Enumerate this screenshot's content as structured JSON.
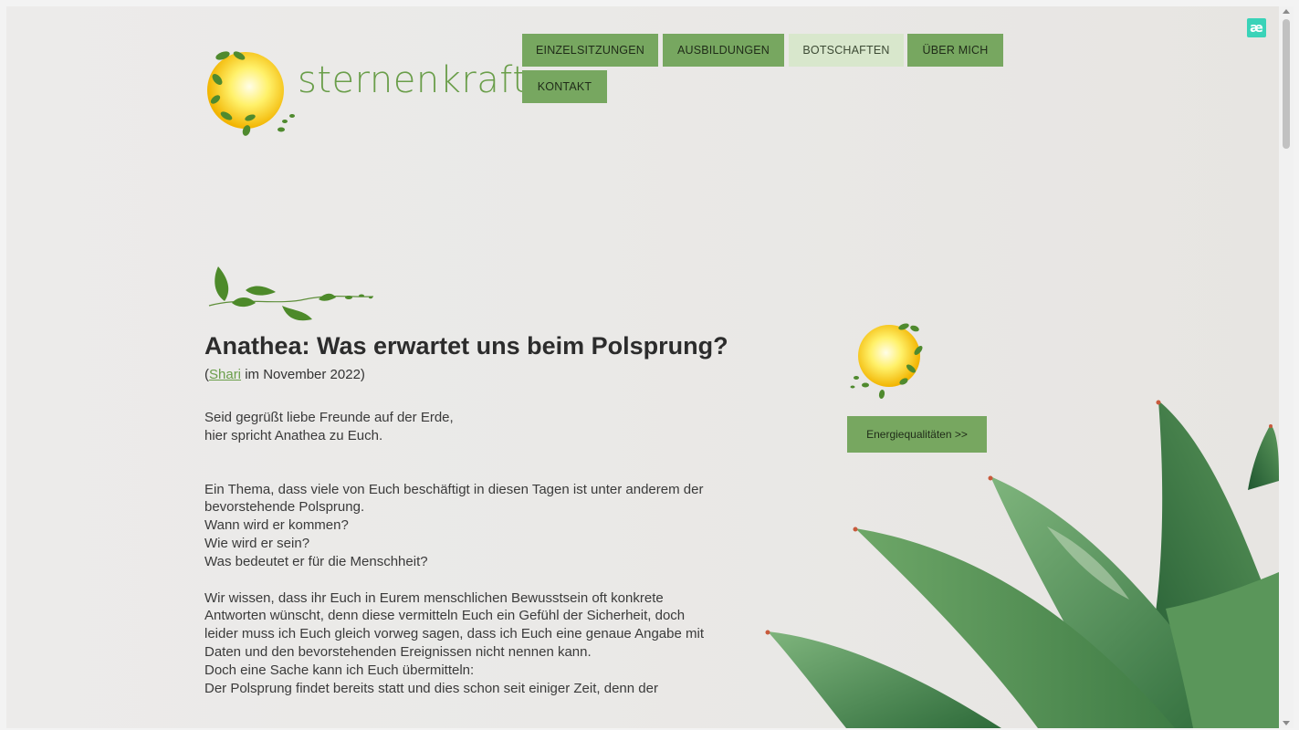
{
  "brand": {
    "name": "sternenkraft",
    "logo_icon": "sun-with-leaves-icon"
  },
  "extension": {
    "label": "æ",
    "icon": "extension-icon"
  },
  "nav": {
    "items": [
      {
        "label": "EINZELSITZUNGEN",
        "active": false
      },
      {
        "label": "AUSBILDUNGEN",
        "active": false
      },
      {
        "label": "BOTSCHAFTEN",
        "active": true
      },
      {
        "label": "ÜBER MICH",
        "active": false
      },
      {
        "label": "KONTAKT",
        "active": false
      }
    ]
  },
  "article": {
    "title": "Anathea: Was erwartet uns beim Polsprung?",
    "byline_open": "(",
    "byline_author": "Shari",
    "byline_rest": " im November 2022)",
    "paragraphs": [
      [
        "Seid gegrüßt liebe Freunde auf der Erde,",
        "hier spricht Anathea zu Euch."
      ],
      [
        "Ein Thema, dass viele von Euch beschäftigt in diesen Tagen ist unter anderem der",
        "bevorstehende Polsprung.",
        "Wann wird er kommen?",
        "Wie wird er sein?",
        "Was bedeutet er für die Menschheit?"
      ],
      [
        "Wir wissen, dass ihr Euch in Eurem menschlichen Bewusstsein oft konkrete",
        "Antworten wünscht, denn diese vermitteln Euch ein Gefühl der Sicherheit, doch",
        "leider muss ich Euch gleich vorweg sagen, dass ich Euch eine genaue Angabe mit",
        "Daten und den bevorstehenden Ereignissen nicht nennen kann.",
        "Doch eine Sache kann ich Euch übermitteln:",
        "Der Polsprung findet bereits statt und dies schon seit einiger Zeit, denn der"
      ]
    ]
  },
  "sidebar": {
    "button_label": "Energiequalitäten >>"
  },
  "colors": {
    "accent": "#77a760",
    "active": "#d8e7cc",
    "text": "#333333",
    "link": "#6a9e4a"
  }
}
